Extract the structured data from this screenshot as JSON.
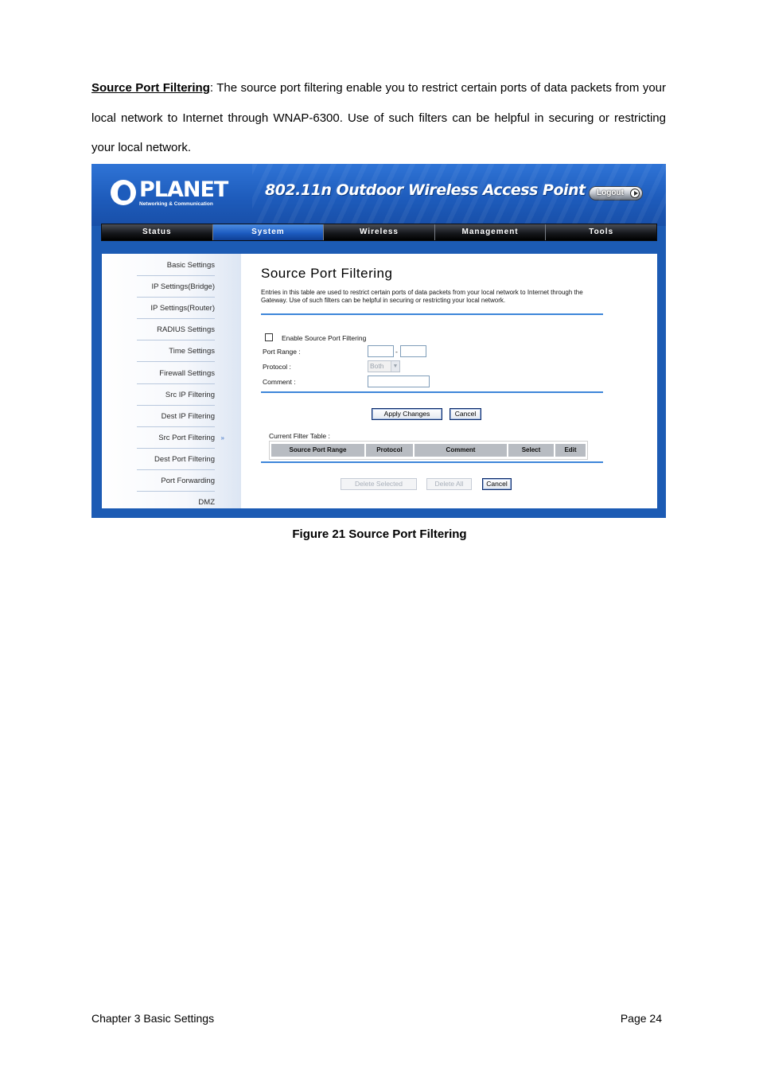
{
  "intro": {
    "term": "Source Port Filtering",
    "text": ": The source port filtering enable you to restrict certain ports of data packets from your local network to Internet through WNAP-6300. Use of such filters can be helpful in securing or restricting your local network."
  },
  "ui": {
    "logo": {
      "word": "PLANET",
      "sub": "Networking & Communication"
    },
    "product_title": "802.11n Outdoor Wireless Access Point",
    "logout_label": "Logout",
    "menu": [
      "Status",
      "System",
      "Wireless",
      "Management",
      "Tools"
    ],
    "active_menu": "System",
    "sidebar": [
      "Basic Settings",
      "IP Settings(Bridge)",
      "IP Settings(Router)",
      "RADIUS Settings",
      "Time Settings",
      "Firewall Settings",
      "Src IP Filtering",
      "Dest IP Filtering",
      "Src Port Filtering",
      "Dest Port Filtering",
      "Port Forwarding",
      "DMZ"
    ],
    "sidebar_current_marker": "»",
    "page_title": "Source Port Filtering",
    "page_description": "Entries in this table are used to restrict certain ports of data packets from your local network to Internet through the Gateway. Use of such filters can be helpful in securing or restricting your local network.",
    "form": {
      "enable_label": "Enable Source Port Filtering",
      "enable_checked": false,
      "port_range_label": "Port Range :",
      "port_range_separator": "-",
      "port_from": "",
      "port_to": "",
      "protocol_label": "Protocol :",
      "protocol_value": "Both",
      "comment_label": "Comment :",
      "comment_value": "",
      "apply_label": "Apply Changes",
      "cancel_label": "Cancel"
    },
    "table": {
      "label": "Current Filter Table :",
      "columns": [
        "Source Port Range",
        "Protocol",
        "Comment",
        "Select",
        "Edit"
      ]
    },
    "bottom_buttons": {
      "delete_selected": "Delete Selected",
      "delete_all": "Delete All",
      "cancel": "Cancel"
    }
  },
  "caption": "Figure 21 Source Port Filtering",
  "footer": {
    "left": "Chapter 3 Basic Settings",
    "right": "Page 24"
  }
}
